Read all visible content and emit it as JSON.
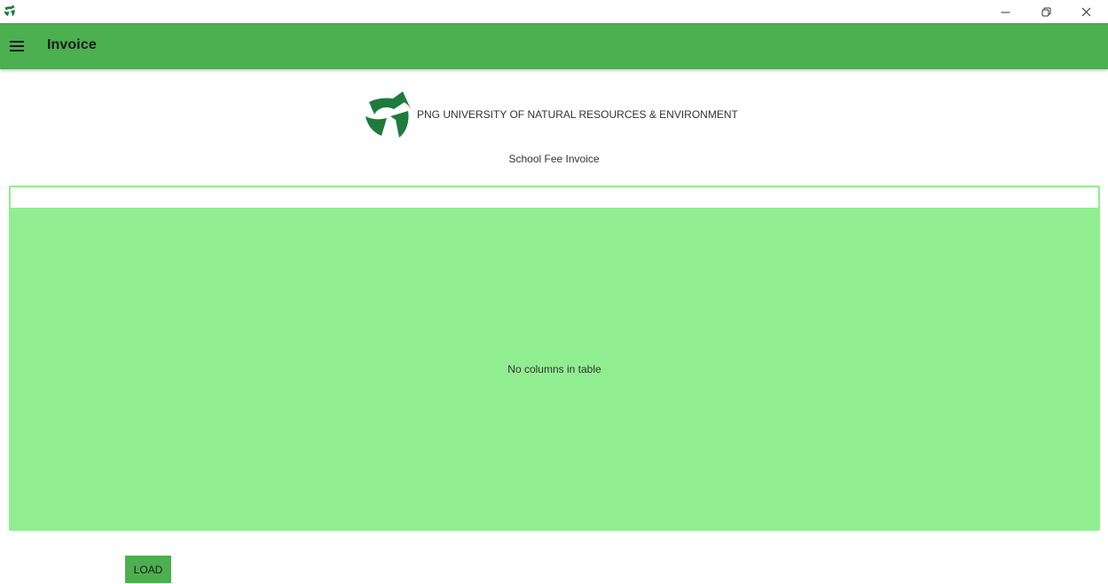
{
  "window": {
    "icon": "app-logo-icon",
    "controls": [
      "minimize-icon",
      "restore-icon",
      "close-icon"
    ]
  },
  "appbar": {
    "menu_icon": "hamburger-menu-icon",
    "title": "Invoice"
  },
  "header": {
    "logo": "university-logo-icon",
    "institution": "PNG UNIVERSITY OF NATURAL RESOURCES & ENVIRONMENT",
    "document_title": "School Fee Invoice"
  },
  "table": {
    "empty_message": "No columns in table"
  },
  "actions": {
    "load_label": "LOAD"
  },
  "colors": {
    "appbar": "#4caf50",
    "table_background": "#90ee90",
    "logo_green": "#1e7b3c",
    "button": "#4caf50"
  }
}
